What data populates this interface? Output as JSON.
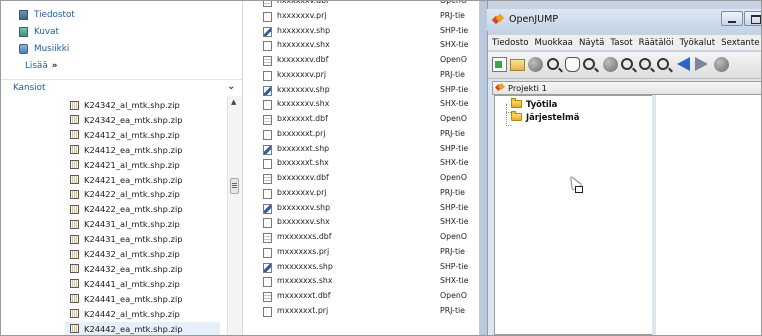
{
  "nav": {
    "libraries": [
      {
        "label": "Tiedostot",
        "icon": "documents-library-icon"
      },
      {
        "label": "Kuvat",
        "icon": "pictures-library-icon"
      },
      {
        "label": "Musiikki",
        "icon": "music-library-icon"
      }
    ],
    "more_label": "Lisää",
    "more_arrow": "»",
    "folders_header": "Kansiot",
    "folders_chevron": "⌄",
    "tree_items": [
      "K24342_al_mtk.shp.zip",
      "K24342_ea_mtk.shp.zip",
      "K24412_al_mtk.shp.zip",
      "K24412_ea_mtk.shp.zip",
      "K24421_al_mtk.shp.zip",
      "K24421_ea_mtk.shp.zip",
      "K24422_al_mtk.shp.zip",
      "K24422_ea_mtk.shp.zip",
      "K24431_al_mtk.shp.zip",
      "K24431_ea_mtk.shp.zip",
      "K24432_al_mtk.shp.zip",
      "K24432_ea_mtk.shp.zip",
      "K24441_al_mtk.shp.zip",
      "K24441_ea_mtk.shp.zip",
      "K24442_al_mtk.shp.zip",
      "K24442_ea_mtk.shp.zip"
    ],
    "selected_index": 15
  },
  "files": [
    {
      "name": "hxxxxxxv.dbf",
      "type": "OpenO",
      "kind": "dbf"
    },
    {
      "name": "hxxxxxxv.prj",
      "type": "PRJ-tie",
      "kind": "prj"
    },
    {
      "name": "hxxxxxxv.shp",
      "type": "SHP-tie",
      "kind": "shp"
    },
    {
      "name": "hxxxxxxv.shx",
      "type": "SHX-tie",
      "kind": "shx"
    },
    {
      "name": "kxxxxxxv.dbf",
      "type": "OpenO",
      "kind": "dbf"
    },
    {
      "name": "kxxxxxxv.prj",
      "type": "PRJ-tie",
      "kind": "prj"
    },
    {
      "name": "kxxxxxxv.shp",
      "type": "SHP-tie",
      "kind": "shp"
    },
    {
      "name": "kxxxxxxv.shx",
      "type": "SHX-tie",
      "kind": "shx"
    },
    {
      "name": "bxxxxxxt.dbf",
      "type": "OpenO",
      "kind": "dbf"
    },
    {
      "name": "bxxxxxxt.prj",
      "type": "PRJ-tie",
      "kind": "prj"
    },
    {
      "name": "bxxxxxxt.shp",
      "type": "SHP-tie",
      "kind": "shp"
    },
    {
      "name": "bxxxxxxt.shx",
      "type": "SHX-tie",
      "kind": "shx"
    },
    {
      "name": "bxxxxxxv.dbf",
      "type": "OpenO",
      "kind": "dbf"
    },
    {
      "name": "bxxxxxxv.prj",
      "type": "PRJ-tie",
      "kind": "prj"
    },
    {
      "name": "bxxxxxxv.shp",
      "type": "SHP-tie",
      "kind": "shp"
    },
    {
      "name": "bxxxxxxv.shx",
      "type": "SHX-tie",
      "kind": "shx"
    },
    {
      "name": "mxxxxxxs.dbf",
      "type": "OpenO",
      "kind": "dbf"
    },
    {
      "name": "mxxxxxxs.prj",
      "type": "PRJ-tie",
      "kind": "prj"
    },
    {
      "name": "mxxxxxxs.shp",
      "type": "SHP-tie",
      "kind": "shp"
    },
    {
      "name": "mxxxxxxs.shx",
      "type": "SHX-tie",
      "kind": "shx"
    },
    {
      "name": "mxxxxxxt.dbf",
      "type": "OpenO",
      "kind": "dbf"
    },
    {
      "name": "mxxxxxxt.prj",
      "type": "PRJ-tie",
      "kind": "prj"
    }
  ],
  "openjump": {
    "title": "OpenJUMP",
    "menu": [
      "Tiedosto",
      "Muokkaa",
      "Näytä",
      "Tasot",
      "Räätälöi",
      "Työkalut",
      "Sextante"
    ],
    "toolbar_icons": [
      "new-project-icon",
      "open-folder-icon",
      "save-icon",
      "zoom-icon",
      "pan-hand-icon",
      "zoom-to-full-icon",
      "stop-icon",
      "zoom-in-icon",
      "zoom-out-icon",
      "zoom-previous-icon",
      "back-arrow-icon",
      "forward-arrow-icon",
      "refresh-icon"
    ],
    "project_title": "Projekti 1",
    "categories": [
      "Työtila",
      "Järjestelmä"
    ]
  }
}
